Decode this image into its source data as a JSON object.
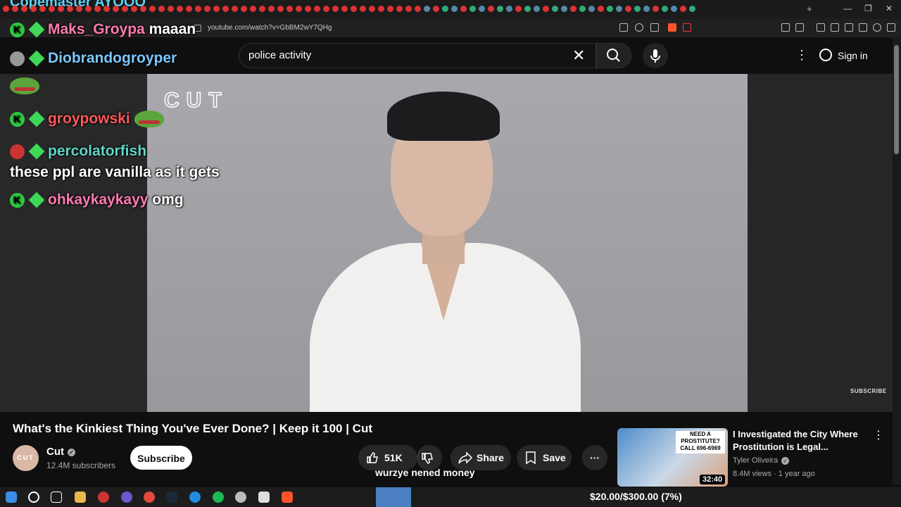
{
  "browser": {
    "url": "youtube.com/watch?v=GbBM2wY7QHg",
    "tab_close": "×",
    "new_tab": "+",
    "window_controls": [
      "—",
      "❐",
      "✕"
    ]
  },
  "youtube": {
    "search_value": "police activity",
    "clear_glyph": "✕",
    "more_glyph": "⋮",
    "sign_in_label": "Sign in"
  },
  "video": {
    "watermark_logo": "CUT",
    "subscribe_watermark": "SUBSCRIBE",
    "title": "What's the Kinkiest Thing You've Ever Done? | Keep it 100 | Cut",
    "channel_name": "Cut",
    "channel_avatar_text": "CUT",
    "verified_glyph": "✓",
    "subscribers": "12.4M subscribers",
    "subscribe_label": "Subscribe",
    "likes": "51K",
    "share_label": "Share",
    "save_label": "Save",
    "more_label": "···"
  },
  "chat_overlay": {
    "top_partial": "Copemaster AYOOO",
    "messages": [
      {
        "user": "Maks_Groypa",
        "text": "maaan",
        "user_color": "#ff7ab0"
      },
      {
        "user": "Diobrandogroyper",
        "text": "",
        "user_color": "#7ac8ff"
      },
      {
        "user": "groypowski",
        "text": "",
        "user_color": "#ff5a5a"
      },
      {
        "user": "percolatorfish",
        "text": "these ppl are vanilla as it gets",
        "user_color": "#5fd6c9"
      },
      {
        "user": "ohkaykaykayy",
        "text": "omg",
        "user_color": "#ff7ab0"
      }
    ],
    "badge_letter": "K",
    "donation_message": "wurzye nened money"
  },
  "recommendation": {
    "title": "I Investigated the City Where Prostitution is Legal...",
    "channel": "Tyler Oliveira",
    "meta": "8.4M views · 1 year ago",
    "duration": "32:40",
    "thumb_sign": "NEED A PROSTITUTE? CALL 696-6969"
  },
  "taskbar": {
    "goal_text": "$20.00/$300.00 (7%)",
    "goal_progress": 0.07
  },
  "colors": {
    "badge_green": "#2ecc40",
    "youtube_red": "#ff0000",
    "background": "#0f0f0f"
  }
}
